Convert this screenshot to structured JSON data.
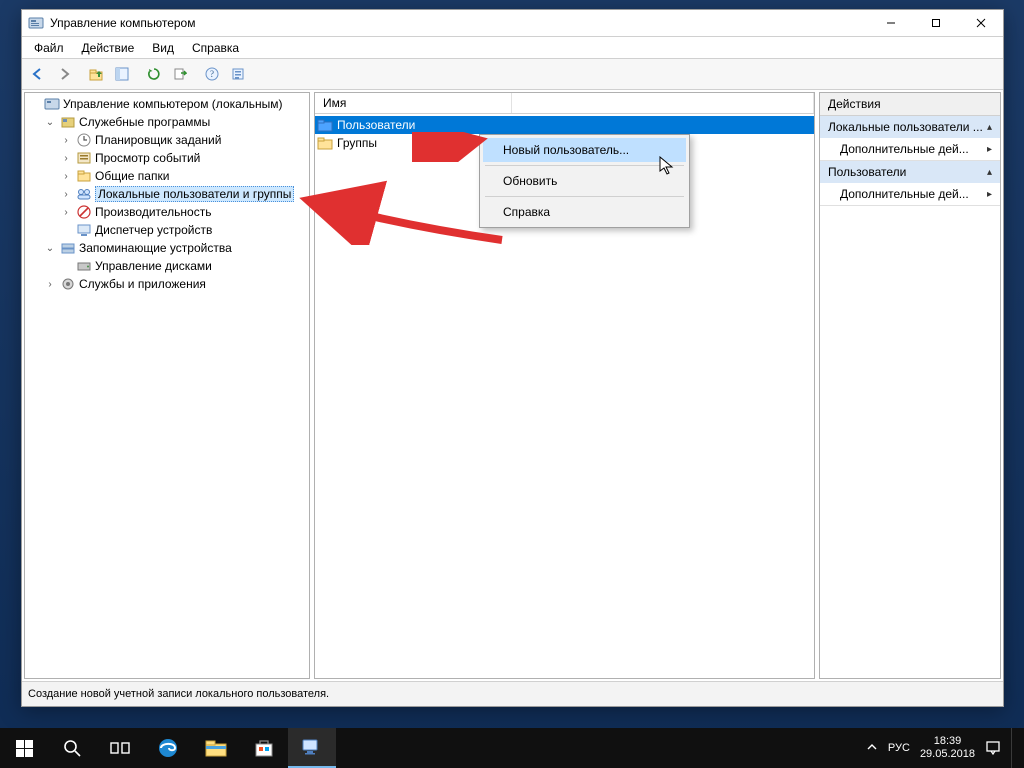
{
  "window": {
    "title": "Управление компьютером"
  },
  "menubar": {
    "file": "Файл",
    "action": "Действие",
    "view": "Вид",
    "help": "Справка"
  },
  "tree": {
    "root": "Управление компьютером (локальным)",
    "system_tools": "Служебные программы",
    "task_scheduler": "Планировщик заданий",
    "event_viewer": "Просмотр событий",
    "shared_folders": "Общие папки",
    "local_users_groups": "Локальные пользователи и группы",
    "performance": "Производительность",
    "device_manager": "Диспетчер устройств",
    "storage": "Запоминающие устройства",
    "disk_management": "Управление дисками",
    "services_apps": "Службы и приложения"
  },
  "list": {
    "column_name": "Имя",
    "row_users": "Пользователи",
    "row_groups": "Группы"
  },
  "context_menu": {
    "new_user": "Новый пользователь...",
    "refresh": "Обновить",
    "help": "Справка"
  },
  "actions": {
    "header": "Действия",
    "section1_title": "Локальные пользователи ...",
    "section1_item": "Дополнительные дей...",
    "section2_title": "Пользователи",
    "section2_item": "Дополнительные дей..."
  },
  "statusbar": {
    "text": "Создание новой учетной записи локального пользователя."
  },
  "taskbar": {
    "lang": "РУС",
    "time": "18:39",
    "date": "29.05.2018"
  }
}
